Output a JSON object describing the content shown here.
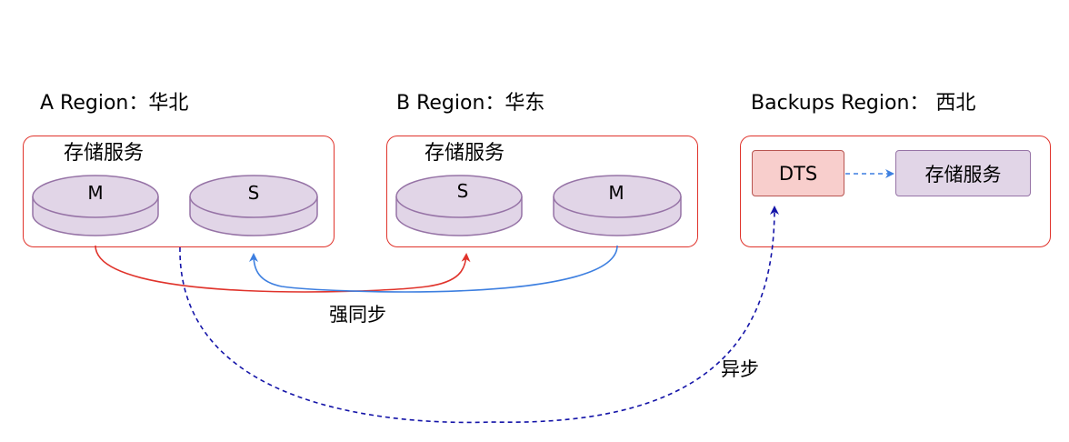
{
  "regions": [
    {
      "title": "A Region：华北",
      "service": "存储服务",
      "nodes": [
        "M",
        "S"
      ]
    },
    {
      "title": "B Region：华东",
      "service": "存储服务",
      "nodes": [
        "S",
        "M"
      ]
    },
    {
      "title": "Backups Region： 西北",
      "dts": "DTS",
      "service": "存储服务"
    }
  ],
  "edges": {
    "sync_label": "强同步",
    "async_label": "异步"
  },
  "colors": {
    "region_border": "#e0332b",
    "disk_fill": "#e1d5e7",
    "disk_stroke": "#9673a6",
    "dts_fill": "#f8cecc",
    "dts_stroke": "#b85450",
    "sync_red": "#e0332b",
    "sync_blue": "#3d7fe0",
    "async_navy": "#1414a8",
    "dts_arrow": "#3d7fe0"
  }
}
